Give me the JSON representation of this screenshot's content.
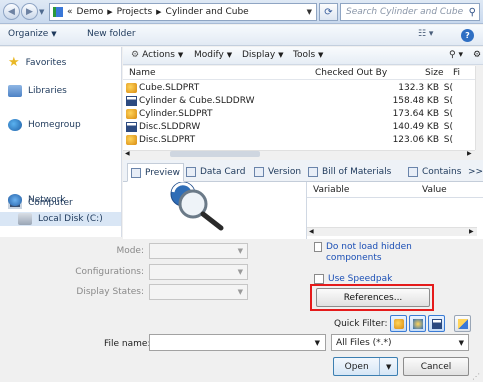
{
  "address": {
    "breadcrumbs": [
      "«",
      "Demo",
      "Projects",
      "Cylinder and Cube"
    ],
    "search_placeholder": "Search Cylinder and Cube"
  },
  "toolbar": {
    "organize": "Organize",
    "new_folder": "New folder"
  },
  "nav": {
    "favorites": "Favorites",
    "libraries": "Libraries",
    "homegroup": "Homegroup",
    "computer": "Computer",
    "local_disk": "Local Disk (C:)",
    "network": "Network"
  },
  "pdm": {
    "actions": "Actions",
    "modify": "Modify",
    "display": "Display",
    "tools": "Tools"
  },
  "columns": {
    "name": "Name",
    "checked_out_by": "Checked Out By",
    "size": "Size",
    "fi": "Fi"
  },
  "files": [
    {
      "name": "Cube.SLDPRT",
      "size": "132.3 KB",
      "type": "part",
      "trunc": "S("
    },
    {
      "name": "Cylinder & Cube.SLDDRW",
      "size": "158.48 KB",
      "type": "drawing",
      "trunc": "S("
    },
    {
      "name": "Cylinder.SLDPRT",
      "size": "173.64 KB",
      "type": "part",
      "trunc": "S("
    },
    {
      "name": "Disc.SLDDRW",
      "size": "140.49 KB",
      "type": "drawing",
      "trunc": "S("
    },
    {
      "name": "Disc.SLDPRT",
      "size": "123.06 KB",
      "type": "part",
      "trunc": "S("
    }
  ],
  "tabs": {
    "preview": "Preview",
    "data_card": "Data Card",
    "version": "Version",
    "bom": "Bill of Materials",
    "contains": "Contains",
    "more": ">>"
  },
  "variables": {
    "variable": "Variable",
    "value": "Value"
  },
  "options": {
    "mode": "Mode:",
    "configurations": "Configurations:",
    "display_states": "Display States:",
    "do_not_load_hidden": "Do not load hidden components",
    "use_speedpak": "Use Speedpak",
    "references": "References...",
    "quick_filter": "Quick Filter:"
  },
  "footer": {
    "file_name_label": "File name:",
    "file_name_value": "",
    "file_type": "All Files (*.*)",
    "open": "Open",
    "cancel": "Cancel"
  },
  "colors": {
    "highlight": "#e51b1b"
  }
}
